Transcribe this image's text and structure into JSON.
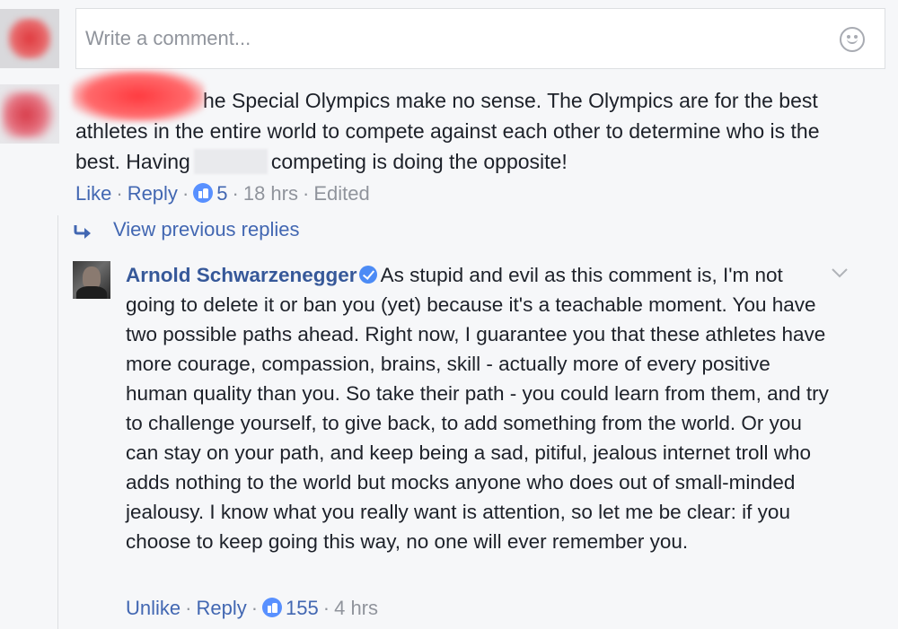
{
  "composer": {
    "placeholder": "Write a comment...",
    "emoji_icon": "smiley-icon"
  },
  "comment": {
    "text_line1": "he Special Olympics make no sense. The Olympics are for the best",
    "text_line2": "athletes in the entire world to compete against each other to determine who is the",
    "text_line3_a": "best. Having",
    "text_line3_b": "competing is doing the opposite!",
    "actions": {
      "like": "Like",
      "reply": "Reply",
      "like_count": "5",
      "time": "18 hrs",
      "edited": "Edited"
    }
  },
  "thread": {
    "view_previous": "View previous replies"
  },
  "reply": {
    "author": "Arnold Schwarzenegger",
    "text": "As stupid and evil as this comment is, I'm not going to delete it or ban you (yet) because it's a teachable moment. You have two possible paths ahead. Right now, I guarantee you that these athletes have more courage, compassion, brains, skill - actually more of every positive human quality than you. So take their path - you could learn from them, and try to challenge yourself, to give back, to add something from the world. Or you can stay on your path, and keep being a sad, pitiful, jealous internet troll who adds nothing to the world but mocks anyone who does out of small-minded jealousy. I know what you really want is attention, so let me be clear: if you choose to keep going this way, no one will ever remember you.",
    "actions": {
      "unlike": "Unlike",
      "reply": "Reply",
      "like_count": "155",
      "time": "4 hrs"
    }
  },
  "colors": {
    "link": "#4267b2",
    "author": "#365899",
    "meta": "#90949c",
    "like_badge": "#5890ff"
  }
}
